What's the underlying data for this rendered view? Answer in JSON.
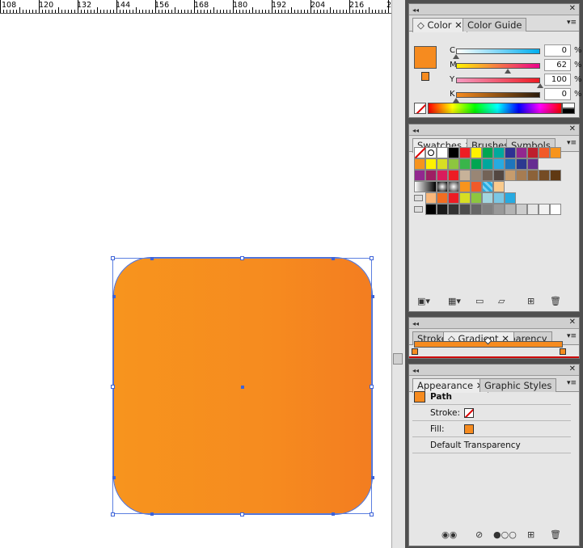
{
  "ruler": {
    "labels": [
      "108",
      "120",
      "132",
      "144",
      "156",
      "168",
      "180",
      "192",
      "204",
      "216",
      "2"
    ]
  },
  "color_panel": {
    "tabs": [
      {
        "label": "Color"
      },
      {
        "label": "Color Guide"
      }
    ],
    "channels": [
      {
        "label": "C",
        "value": "0",
        "pct": "%",
        "pos": 0.0
      },
      {
        "label": "M",
        "value": "62",
        "pct": "%",
        "pos": 0.62
      },
      {
        "label": "Y",
        "value": "100",
        "pct": "%",
        "pos": 1.0
      },
      {
        "label": "K",
        "value": "0",
        "pct": "%",
        "pos": 0.0
      }
    ],
    "fill_color": "#f68b1f"
  },
  "swatches_panel": {
    "tabs": [
      {
        "label": "Swatches"
      },
      {
        "label": "Brushes"
      },
      {
        "label": "Symbols"
      }
    ],
    "row1": [
      "#ffffff",
      "#000000",
      "#ed1c24",
      "#fff200",
      "#00a651",
      "#00a99d",
      "#2e3192",
      "#92278f",
      "#be1e2d",
      "#f15a29",
      "#f7941d"
    ],
    "row2": [
      "#f7941d",
      "#fff200",
      "#d7df23",
      "#8dc63f",
      "#39b54a",
      "#00a651",
      "#00a79d",
      "#27aae1",
      "#1c75bc",
      "#2b3990",
      "#662d91"
    ],
    "row3": [
      "#92278f",
      "#9e1f63",
      "#d91c5c",
      "#ed1c24",
      "#c7b299",
      "#998675",
      "#736357",
      "#534741",
      "#c69c6d",
      "#a67c52",
      "#8c6239",
      "#754c24",
      "#603913"
    ],
    "row4": [
      "#4d4d4d",
      "#808080",
      "#f7941d",
      "#f15a29",
      "#27aae1",
      "#f9ca8c"
    ],
    "row5": [
      "#f9b77a",
      "#f26d21",
      "#ed1c24",
      "#d7df23",
      "#8dc63f",
      "#a3d5e0",
      "#7ac7e4",
      "#27aae1"
    ],
    "row6": [
      "#000000",
      "#1a1a1a",
      "#333333",
      "#4d4d4d",
      "#666666",
      "#808080",
      "#999999",
      "#b3b3b3",
      "#cccccc",
      "#e6e6e6",
      "#f2f2f2",
      "#ffffff"
    ]
  },
  "gradient_panel": {
    "tabs": [
      {
        "label": "Stroke"
      },
      {
        "label": "Gradient"
      },
      {
        "label": "Transparency"
      }
    ],
    "visible_label": "nsparency"
  },
  "appearance_panel": {
    "tabs": [
      {
        "label": "Appearance"
      },
      {
        "label": "Graphic Styles"
      }
    ],
    "object": "Path",
    "stroke_label": "Stroke:",
    "fill_label": "Fill:",
    "transparency": "Default Transparency",
    "fill_color": "#f68b1f"
  }
}
